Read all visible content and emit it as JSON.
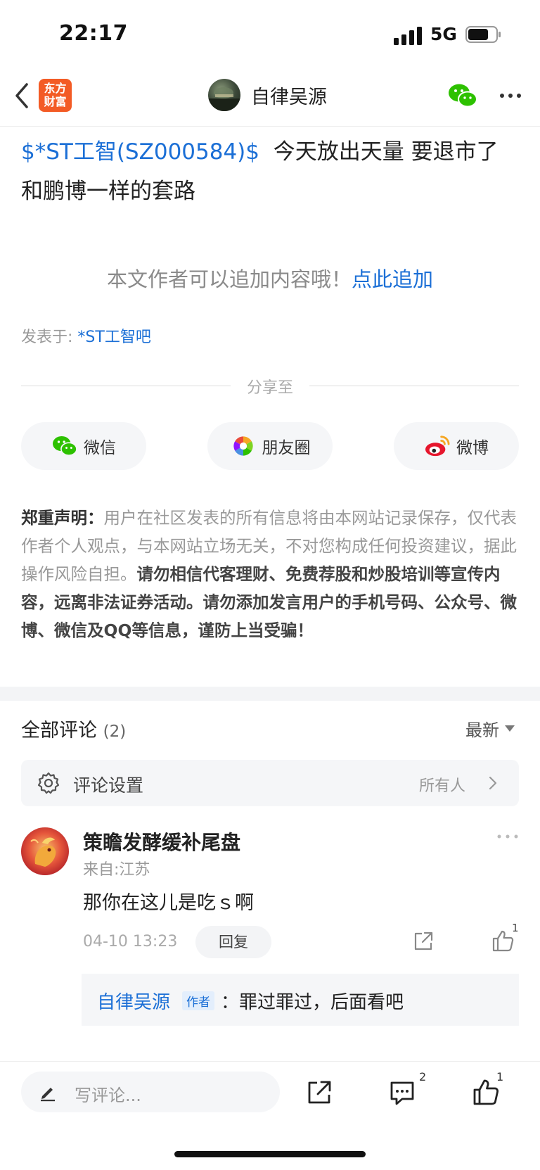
{
  "status_bar": {
    "time": "22:17",
    "network": "5G"
  },
  "nav": {
    "app_logo_text": "东方财富",
    "app_logo_line1": "东方",
    "app_logo_line2": "财富",
    "author_name": "自律吴源"
  },
  "post": {
    "stock_tag": "$*ST工智(SZ000584)$",
    "text": "今天放出天量 要退市了 和鹏博一样的套路",
    "append_hint": "本文作者可以追加内容哦！",
    "append_link": "点此追加",
    "posted_in_label": "发表于:",
    "forum_name": "*ST工智吧"
  },
  "share": {
    "title": "分享至",
    "buttons": [
      {
        "label": "微信",
        "icon": "wechat-icon"
      },
      {
        "label": "朋友圈",
        "icon": "moments-icon"
      },
      {
        "label": "微博",
        "icon": "weibo-icon"
      }
    ]
  },
  "disclaimer": {
    "label": "郑重声明：",
    "normal": "用户在社区发表的所有信息将由本网站记录保存，仅代表作者个人观点，与本网站立场无关，不对您构成任何投资建议，据此操作风险自担。",
    "bold": "请勿相信代客理财、免费荐股和炒股培训等宣传内容，远离非法证券活动。请勿添加发言用户的手机号码、公众号、微博、微信及QQ等信息，谨防上当受骗！"
  },
  "comments": {
    "title": "全部评论",
    "count": "(2)",
    "sort": "最新",
    "settings_label": "评论设置",
    "settings_value": "所有人",
    "items": [
      {
        "name": "策瞻发酵缓补尾盘",
        "location": "来自:江苏",
        "text": "那你在这儿是吃ｓ啊",
        "time": "04-10 13:23",
        "reply_label": "回复",
        "likes": "1",
        "reply": {
          "author": "自律吴源",
          "tag": "作者",
          "separator": "：",
          "text": "罪过罪过，后面看吧"
        }
      }
    ]
  },
  "bottom_bar": {
    "placeholder": "写评论...",
    "comment_count": "2",
    "like_count": "1"
  },
  "colors": {
    "link_blue": "#1b6fd6",
    "brand_orange": "#f35b25",
    "wechat_green": "#2dc100"
  }
}
